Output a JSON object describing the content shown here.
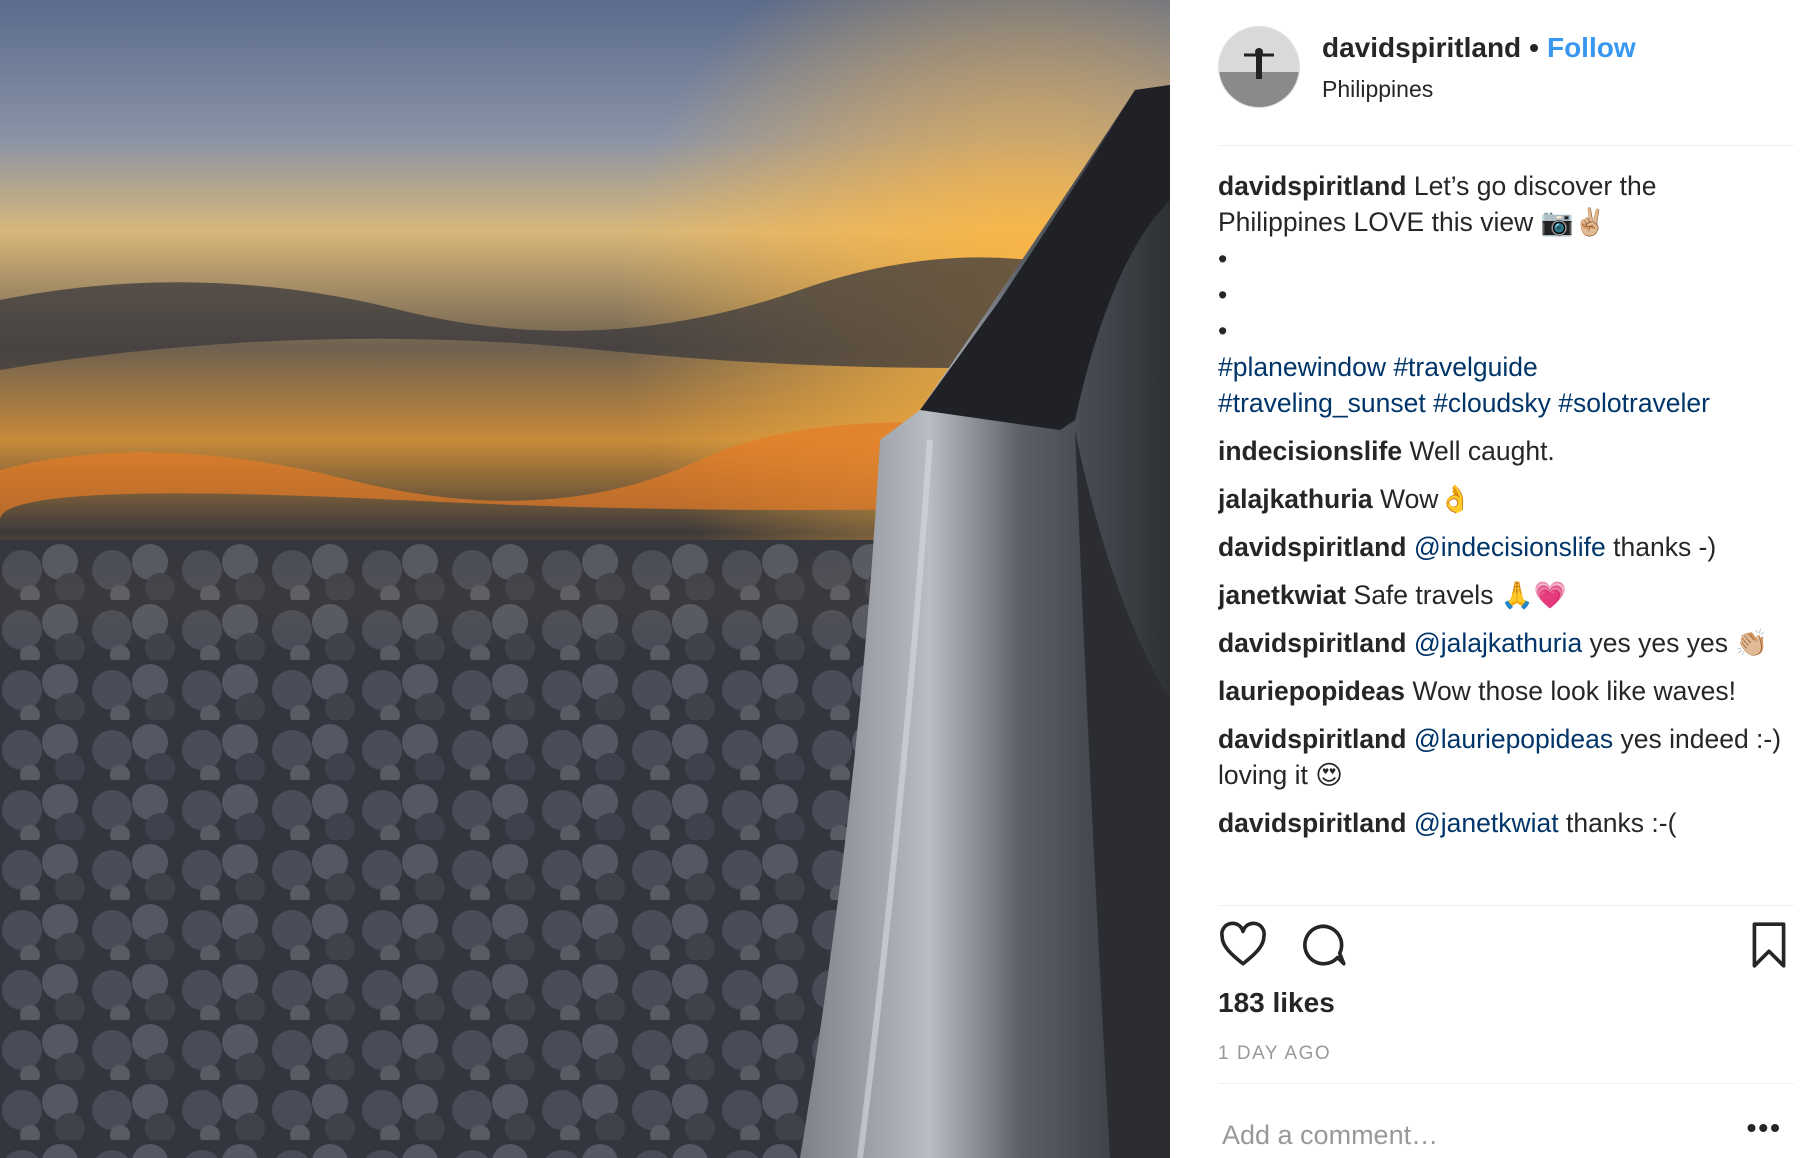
{
  "post": {
    "username": "davidspiritland",
    "separator": "•",
    "follow_label": "Follow",
    "location": "Philippines"
  },
  "caption": {
    "user": "davidspiritland",
    "text": "Let’s go discover the Philippines LOVE this view",
    "emojis": "📷✌🏼",
    "bullets": [
      "•",
      "•",
      "•"
    ],
    "hashtags_line1": "#planewindow #travelguide",
    "hashtags_line2": "#traveling_sunset #cloudsky #solotraveler"
  },
  "comments": [
    {
      "user": "indecisionslife",
      "mention": "",
      "text": "Well caught."
    },
    {
      "user": "jalajkathuria",
      "mention": "",
      "text": "Wow👌"
    },
    {
      "user": "davidspiritland",
      "mention": "@indecisionslife",
      "text": " thanks -)"
    },
    {
      "user": "janetkwiat",
      "mention": "",
      "text": "Safe travels 🙏💗"
    },
    {
      "user": "davidspiritland",
      "mention": "@jalajkathuria",
      "text": " yes yes yes 👏🏼"
    },
    {
      "user": "lauriepopideas",
      "mention": "",
      "text": "Wow those look like waves!"
    },
    {
      "user": "davidspiritland",
      "mention": "@lauriepopideas",
      "text": " yes indeed :-) loving it 😍"
    },
    {
      "user": "davidspiritland",
      "mention": "@janetkwiat",
      "text": " thanks :-("
    }
  ],
  "actions": {
    "like_icon": "heart-icon",
    "comment_icon": "comment-icon",
    "save_icon": "bookmark-icon"
  },
  "likes": "183 likes",
  "time_ago": "1 DAY AGO",
  "add_comment_placeholder": "Add a comment…",
  "more_label": "•••",
  "colors": {
    "follow": "#3897f0",
    "link": "#003569",
    "meta": "#999999",
    "text": "#262626"
  }
}
